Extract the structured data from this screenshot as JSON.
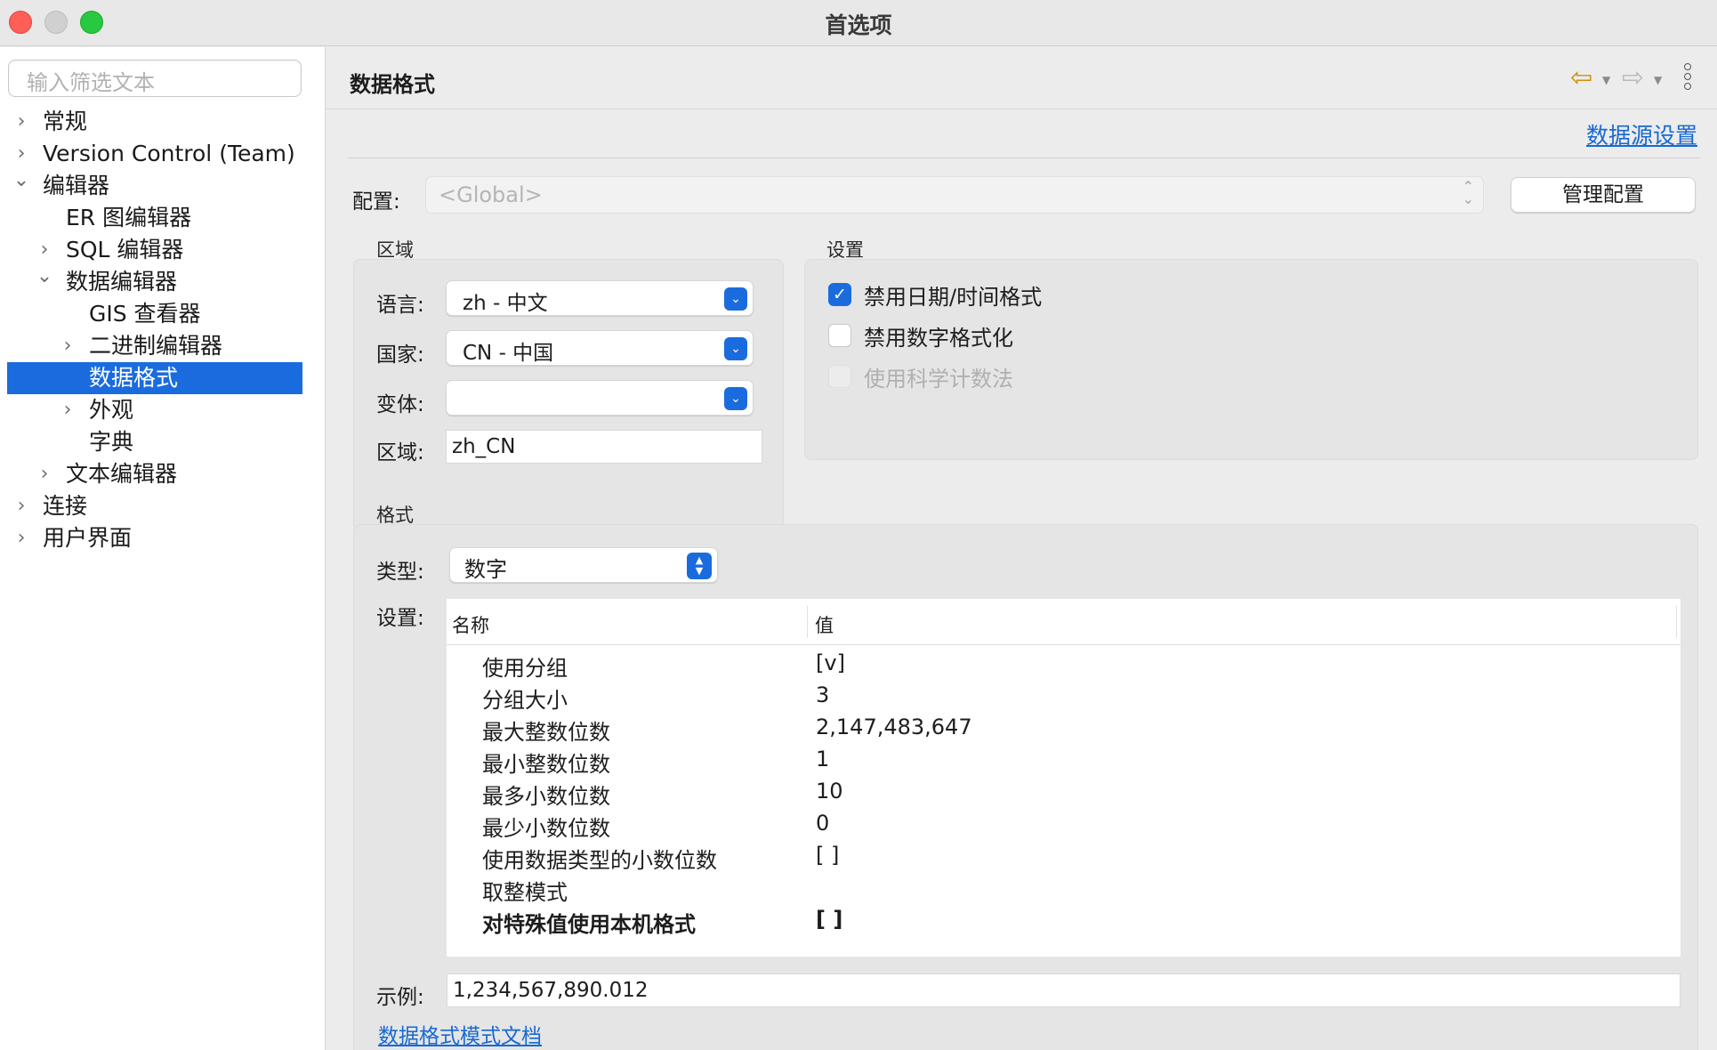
{
  "window": {
    "title": "首选项"
  },
  "sidebar": {
    "filter_placeholder": "输入筛选文本",
    "tree": [
      {
        "label": "常规",
        "level": 0,
        "state": "collapsed"
      },
      {
        "label": "Version Control (Team)",
        "level": 0,
        "state": "collapsed"
      },
      {
        "label": "编辑器",
        "level": 0,
        "state": "expanded"
      },
      {
        "label": "ER 图编辑器",
        "level": 1,
        "state": "leaf"
      },
      {
        "label": "SQL 编辑器",
        "level": 1,
        "state": "collapsed"
      },
      {
        "label": "数据编辑器",
        "level": 1,
        "state": "expanded"
      },
      {
        "label": "GIS 查看器",
        "level": 2,
        "state": "leaf"
      },
      {
        "label": "二进制编辑器",
        "level": 2,
        "state": "collapsed"
      },
      {
        "label": "数据格式",
        "level": 2,
        "state": "leaf",
        "selected": true
      },
      {
        "label": "外观",
        "level": 2,
        "state": "collapsed"
      },
      {
        "label": "字典",
        "level": 2,
        "state": "leaf"
      },
      {
        "label": "文本编辑器",
        "level": 1,
        "state": "collapsed"
      },
      {
        "label": "连接",
        "level": 0,
        "state": "collapsed"
      },
      {
        "label": "用户界面",
        "level": 0,
        "state": "collapsed"
      }
    ]
  },
  "page": {
    "title": "数据格式",
    "datasource_link": "数据源设置",
    "profile_label": "配置:",
    "profile_value": "<Global>",
    "manage_button": "管理配置"
  },
  "region": {
    "title": "区域",
    "language_label": "语言:",
    "language_value": "zh - 中文",
    "country_label": "国家:",
    "country_value": "CN - 中国",
    "variant_label": "变体:",
    "variant_value": "",
    "locale_label": "区域:",
    "locale_value": "zh_CN"
  },
  "settings": {
    "title": "设置",
    "options": [
      {
        "label": "禁用日期/时间格式",
        "checked": true,
        "enabled": true
      },
      {
        "label": "禁用数字格式化",
        "checked": false,
        "enabled": true
      },
      {
        "label": "使用科学计数法",
        "checked": false,
        "enabled": false
      }
    ]
  },
  "format": {
    "title": "格式",
    "type_label": "类型:",
    "type_value": "数字",
    "settings_label": "设置:",
    "columns": [
      "名称",
      "值"
    ],
    "rows": [
      {
        "name": "使用分组",
        "value": "[v]",
        "bold": false
      },
      {
        "name": "分组大小",
        "value": "3",
        "bold": false
      },
      {
        "name": "最大整数位数",
        "value": "2,147,483,647",
        "bold": false
      },
      {
        "name": "最小整数位数",
        "value": "1",
        "bold": false
      },
      {
        "name": "最多小数位数",
        "value": "10",
        "bold": false
      },
      {
        "name": "最少小数位数",
        "value": "0",
        "bold": false
      },
      {
        "name": "使用数据类型的小数位数",
        "value": "[ ]",
        "bold": false
      },
      {
        "name": "取整模式",
        "value": "",
        "bold": false
      },
      {
        "name": "对特殊值使用本机格式",
        "value": "[ ]",
        "bold": true
      }
    ],
    "sample_label": "示例:",
    "sample_value": "1,234,567,890.012",
    "doc_link": "数据格式模式文档"
  },
  "colors": {
    "accent": "#1a6cde",
    "link": "#1769d2",
    "back_arrow": "#c9910e",
    "forward_arrow": "#b9b9b9"
  }
}
